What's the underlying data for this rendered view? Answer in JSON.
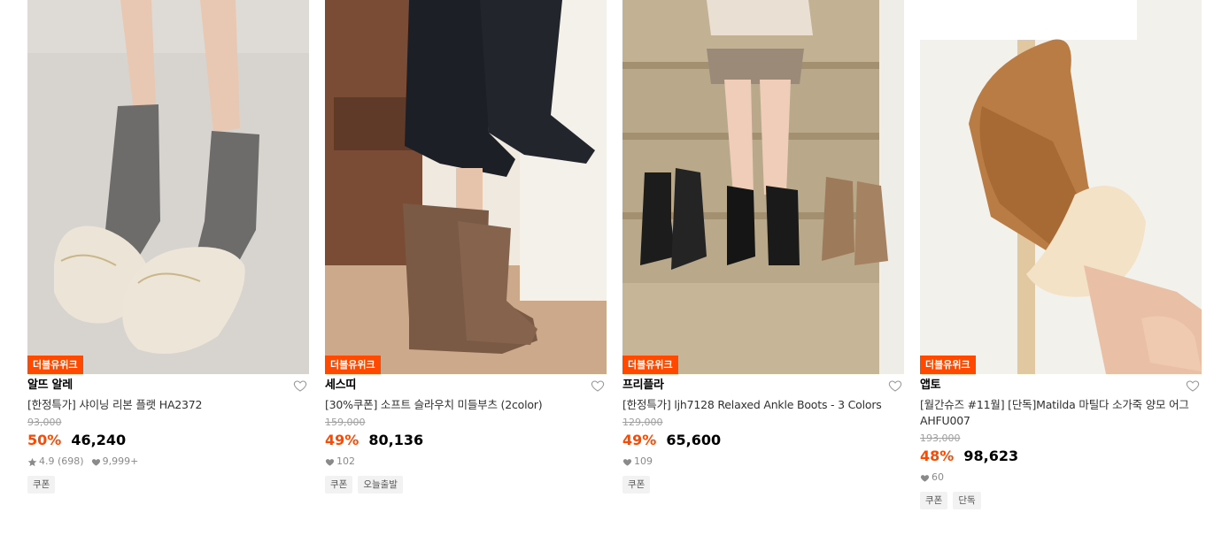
{
  "products": [
    {
      "badge": "더블유위크",
      "brand": "알뜨 알레",
      "name": "[한정특가] 샤이닝 리본 플랫 HA2372",
      "original_price": "93,000",
      "discount": "50%",
      "price": "46,240",
      "rating": "4.9",
      "review_count": "(698)",
      "likes": "9,999+",
      "tags": [
        "쿠폰"
      ]
    },
    {
      "badge": "더블유위크",
      "brand": "세스띠",
      "name": "[30%쿠폰] 소프트 슬라우치 미들부츠 (2color)",
      "original_price": "159,000",
      "discount": "49%",
      "price": "80,136",
      "likes": "102",
      "tags": [
        "쿠폰",
        "오늘출발"
      ]
    },
    {
      "badge": "더블유위크",
      "brand": "프리플라",
      "name": "[한정특가] ljh7128 Relaxed Ankle Boots - 3 Colors",
      "original_price": "129,000",
      "discount": "49%",
      "price": "65,600",
      "likes": "109",
      "tags": [
        "쿠폰"
      ]
    },
    {
      "badge": "더블유위크",
      "brand": "앱토",
      "name": "[월간슈즈 #11월] [단독]Matilda 마틸다 소가죽 양모 어그 AHFU007",
      "original_price": "193,000",
      "discount": "48%",
      "price": "98,623",
      "likes": "60",
      "tags": [
        "쿠폰",
        "단독"
      ]
    }
  ],
  "colors": {
    "accent": "#ff4800",
    "text": "#000000",
    "muted": "#8a8a8a",
    "chip_bg": "#f2f2f2"
  }
}
